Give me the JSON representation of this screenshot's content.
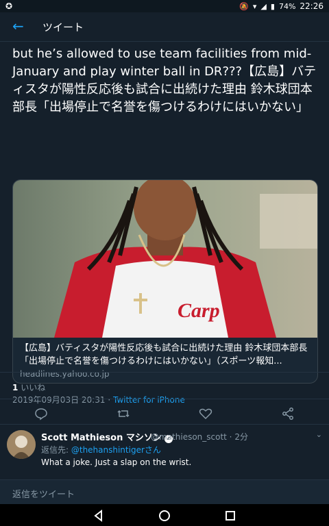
{
  "status_bar": {
    "battery": "74%",
    "time": "22:26"
  },
  "app_bar": {
    "title": "ツイート"
  },
  "tweet": {
    "text": "but he’s allowed to use team facilities from mid-January and play winter ball in DR???【広島】バティスタが陽性反応後も試合に出続けた理由 鈴木球団本部長「出場停止で名誉を傷つけるわけにはいかない」",
    "card": {
      "title": "【広島】バティスタが陽性反応後も試合に出続けた理由 鈴木球団本部長「出場停止で名誉を傷つけるわけにはいかない」（スポーツ報知...",
      "domain": "headlines.yahoo.co.jp",
      "image_text": "Carp"
    },
    "timestamp": "2019年09月03日 20:31",
    "separator": "·",
    "source": "Twitter for iPhone",
    "likes_count": "1",
    "likes_label": "いいね"
  },
  "actions": [
    "reply-icon",
    "retweet-icon",
    "like-icon",
    "share-icon"
  ],
  "reply": {
    "name": "Scott Mathieson マシソン",
    "handle": "@mathieson_scott · 2分",
    "replying_prefix": "返信先: ",
    "replying_mention": "@thehanshintigerさん",
    "text": "What a joke. Just a slap on the wrist."
  },
  "compose": {
    "placeholder": "返信をツイート"
  },
  "colors": {
    "background": "#15202b",
    "accent": "#1da1f2",
    "muted": "#8899a6"
  }
}
